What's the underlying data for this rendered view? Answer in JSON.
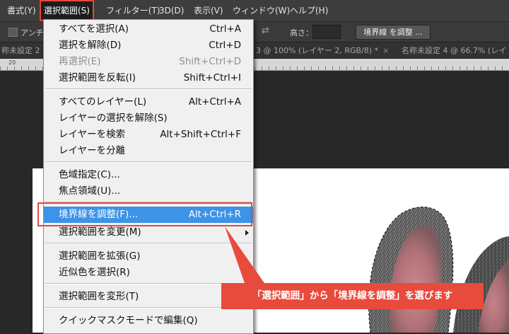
{
  "menubar": {
    "items": [
      {
        "label": "書式(Y)"
      },
      {
        "label": "選択範囲(S)"
      },
      {
        "label": "フィルター(T)"
      },
      {
        "label": "3D(D)"
      },
      {
        "label": "表示(V)"
      },
      {
        "label": "ウィンドウ(W)"
      },
      {
        "label": "ヘルプ(H)"
      }
    ]
  },
  "options": {
    "anti_label": "アンチ",
    "height_label": "高さ：",
    "refine_button": "境界線 を調整 ..."
  },
  "tabs": [
    {
      "label": "称未設定 2"
    },
    {
      "label": "3 @ 100% (レイヤー 2, RGB/8) *"
    },
    {
      "label": "名称未設定 4 @ 66.7% (レイ"
    }
  ],
  "ruler": [
    "20"
  ],
  "menu": {
    "select_all": {
      "label": "すべてを選択(A)",
      "shortcut": "Ctrl+A"
    },
    "deselect": {
      "label": "選択を解除(D)",
      "shortcut": "Ctrl+D"
    },
    "reselect": {
      "label": "再選択(E)",
      "shortcut": "Shift+Ctrl+D"
    },
    "inverse": {
      "label": "選択範囲を反転(I)",
      "shortcut": "Shift+Ctrl+I"
    },
    "all_layers": {
      "label": "すべてのレイヤー(L)",
      "shortcut": "Alt+Ctrl+A"
    },
    "deselect_layers": {
      "label": "レイヤーの選択を解除(S)",
      "shortcut": ""
    },
    "find_layers": {
      "label": "レイヤーを検索",
      "shortcut": "Alt+Shift+Ctrl+F"
    },
    "isolate_layers": {
      "label": "レイヤーを分離",
      "shortcut": ""
    },
    "color_range": {
      "label": "色域指定(C)...",
      "shortcut": ""
    },
    "focus_area": {
      "label": "焦点領域(U)...",
      "shortcut": ""
    },
    "refine_edge": {
      "label": "境界線を調整(F)...",
      "shortcut": "Alt+Ctrl+R"
    },
    "modify": {
      "label": "選択範囲を変更(M)",
      "shortcut": ""
    },
    "grow": {
      "label": "選択範囲を拡張(G)",
      "shortcut": ""
    },
    "similar": {
      "label": "近似色を選択(R)",
      "shortcut": ""
    },
    "transform": {
      "label": "選択範囲を変形(T)",
      "shortcut": ""
    },
    "quick_mask": {
      "label": "クイックマスクモードで編集(Q)",
      "shortcut": ""
    }
  },
  "callout": {
    "text": "「選択範囲」から「境界線を調整」を選びます"
  },
  "colors": {
    "accent": "#e84b3c",
    "highlight": "#3c93e7"
  }
}
